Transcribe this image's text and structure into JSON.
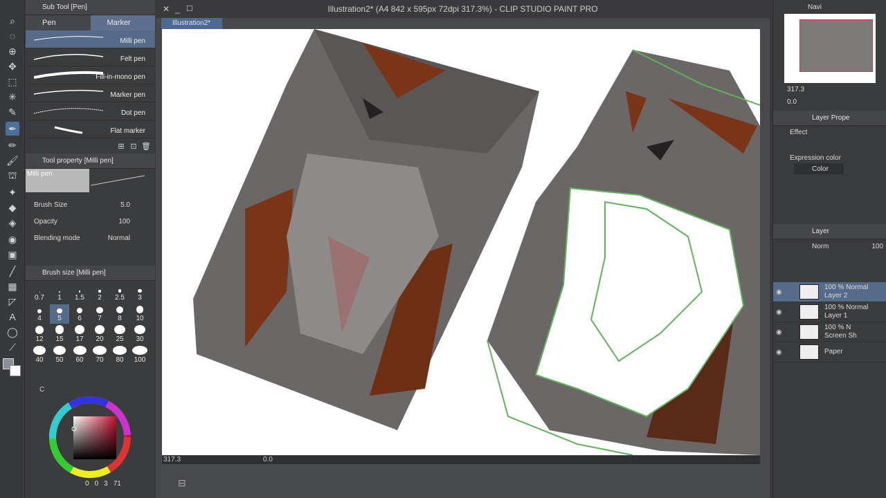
{
  "app": {
    "title": "Illustration2* (A4 842 x 595px 72dpi 317.3%)  - CLIP STUDIO PAINT PRO",
    "doc_tab": "Illustration2*"
  },
  "subtool": {
    "header": "Sub Tool [Pen]",
    "tabs": [
      "Pen",
      "Marker"
    ],
    "brushes": [
      "Milli pen",
      "Felt pen",
      "Fill-in-mono pen",
      "Marker pen",
      "Dot pen",
      "Flat marker"
    ]
  },
  "toolprop": {
    "header": "Tool property [Milli pen]",
    "preview_label": "Milli pen",
    "brush_size_label": "Brush Size",
    "brush_size": "5.0",
    "opacity_label": "Opacity",
    "opacity": "100",
    "blend_label": "Blending mode",
    "blend": "Normal"
  },
  "brushsize": {
    "header": "Brush size [Milli pen]",
    "sizes": [
      "0.7",
      "1",
      "1.5",
      "2",
      "2.5",
      "3",
      "4",
      "5",
      "6",
      "7",
      "8",
      "10",
      "12",
      "15",
      "17",
      "20",
      "25",
      "30",
      "40",
      "50",
      "60",
      "70",
      "80",
      "100"
    ]
  },
  "color": {
    "footer": [
      "0",
      "0",
      "3",
      "71"
    ],
    "c_label": "C"
  },
  "status": {
    "zoom": "317.3",
    "rotate": "0.0"
  },
  "navigator": {
    "label": "Navi",
    "zoom": "317.3",
    "angle": "0.0"
  },
  "layerprop": {
    "header": "Layer Prope",
    "effect": "Effect",
    "expr_label": "Expression color",
    "expr_value": "Color"
  },
  "layers": {
    "header": "Layer",
    "blend": "Norm",
    "opacity": "100",
    "rows": [
      {
        "pct": "100 %",
        "mode": "Normal",
        "name": "Layer 2"
      },
      {
        "pct": "100 %",
        "mode": "Normal",
        "name": "Layer 1"
      },
      {
        "pct": "100 %",
        "mode": "N",
        "name": "Screen Sh"
      },
      {
        "pct": "",
        "mode": "",
        "name": "Paper"
      }
    ]
  },
  "colors": {
    "accent": "#566a8a",
    "outline": "#5fb35a",
    "rust": "#7a3418"
  }
}
